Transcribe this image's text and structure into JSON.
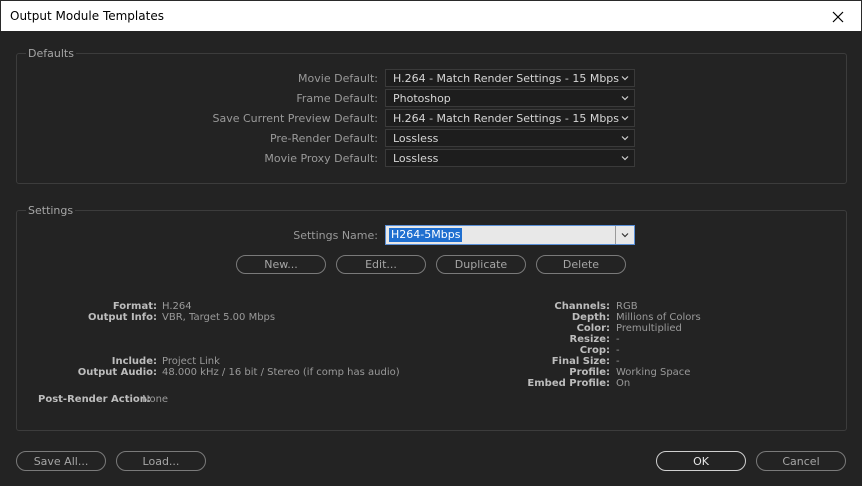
{
  "window": {
    "title": "Output Module Templates"
  },
  "defaults": {
    "label": "Defaults",
    "rows": [
      {
        "label": "Movie Default:",
        "value": "H.264 - Match Render Settings - 15 Mbps"
      },
      {
        "label": "Frame Default:",
        "value": "Photoshop"
      },
      {
        "label": "Save Current Preview Default:",
        "value": "H.264 - Match Render Settings - 15 Mbps"
      },
      {
        "label": "Pre-Render Default:",
        "value": "Lossless"
      },
      {
        "label": "Movie Proxy Default:",
        "value": "Lossless"
      }
    ]
  },
  "settings": {
    "label": "Settings",
    "name_label": "Settings Name:",
    "name_value": "H264-5Mbps",
    "buttons": {
      "new": "New...",
      "edit": "Edit...",
      "duplicate": "Duplicate",
      "delete": "Delete"
    },
    "left_info": [
      {
        "label": "Format:",
        "value": "H.264"
      },
      {
        "label": "Output Info:",
        "value": "VBR, Target 5.00 Mbps"
      },
      {
        "label": "Include:",
        "value": "Project Link"
      },
      {
        "label": "Output Audio:",
        "value": "48.000 kHz / 16 bit / Stereo (if comp has audio)"
      }
    ],
    "post_render": {
      "label": "Post-Render Action:",
      "value": "None"
    },
    "right_info": [
      {
        "label": "Channels:",
        "value": "RGB"
      },
      {
        "label": "Depth:",
        "value": "Millions of Colors"
      },
      {
        "label": "Color:",
        "value": "Premultiplied"
      },
      {
        "label": "Resize:",
        "value": "-"
      },
      {
        "label": "Crop:",
        "value": "-"
      },
      {
        "label": "Final Size:",
        "value": "-"
      },
      {
        "label": "Profile:",
        "value": "Working Space"
      },
      {
        "label": "Embed Profile:",
        "value": "On"
      }
    ]
  },
  "footer": {
    "save_all": "Save All...",
    "load": "Load...",
    "ok": "OK",
    "cancel": "Cancel"
  },
  "colors": {
    "selection": "#1f6fd0",
    "background": "#232323"
  }
}
